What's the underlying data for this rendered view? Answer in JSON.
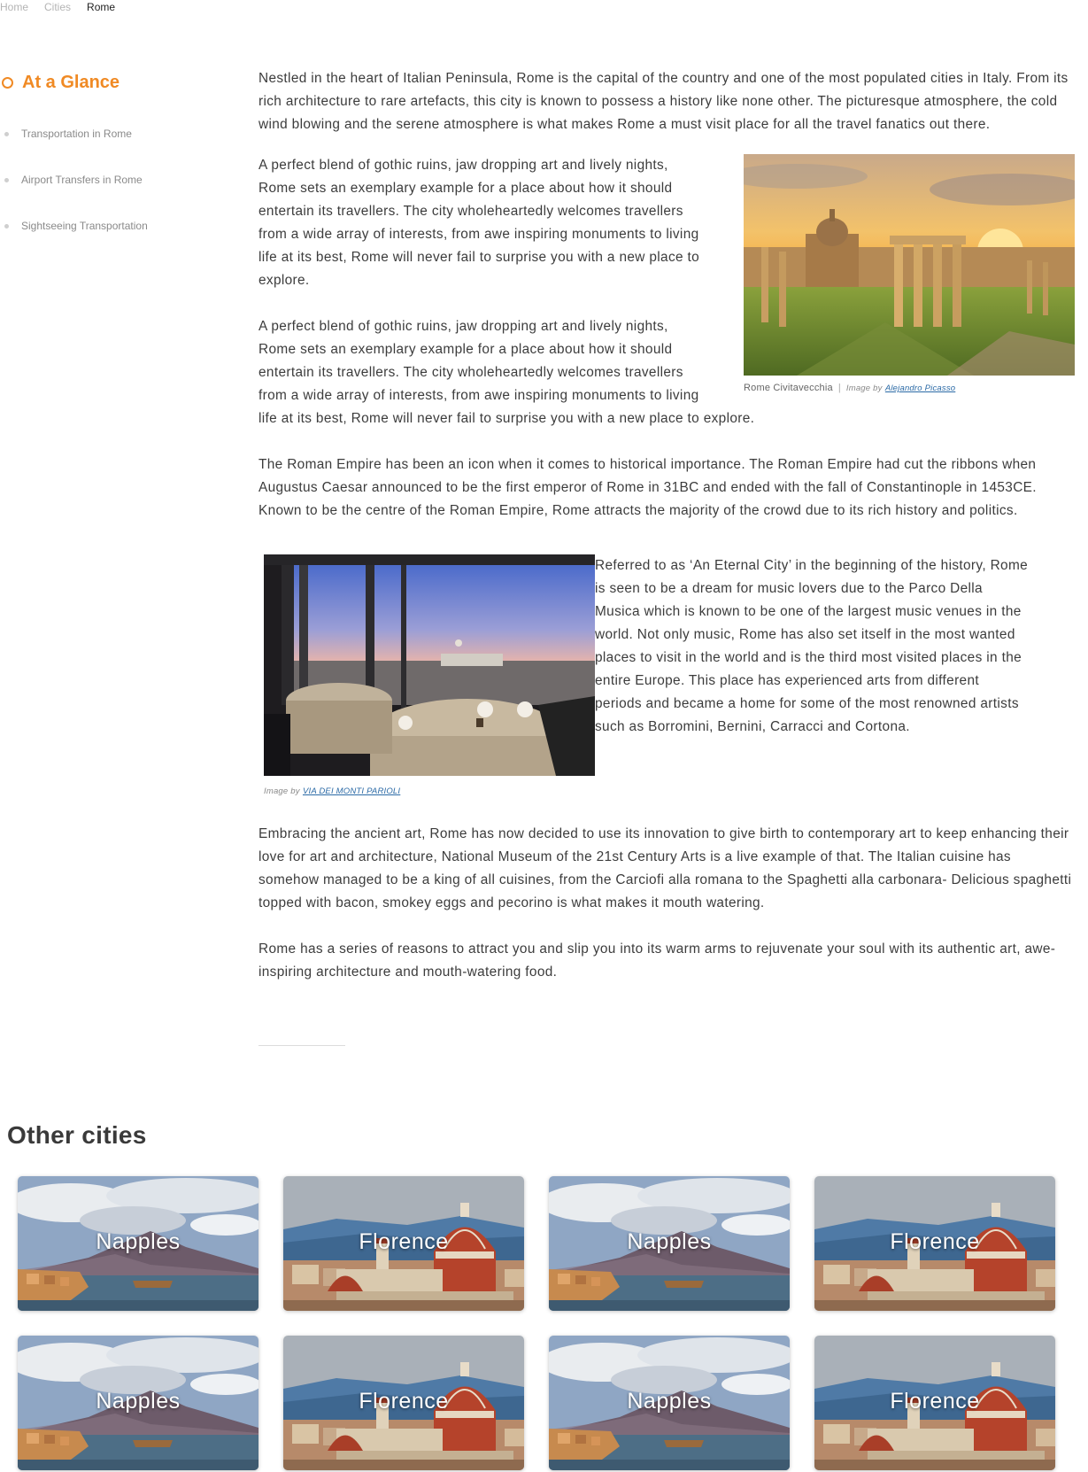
{
  "breadcrumb": {
    "home": "Home",
    "cities": "Cities",
    "current": "Rome"
  },
  "sidenav": {
    "active": "At a Glance",
    "items": [
      {
        "label": "Transportation in Rome"
      },
      {
        "label": "Airport Transfers in Rome"
      },
      {
        "label": "Sightseeing Transportation"
      }
    ]
  },
  "article": {
    "p1": "Nestled in the heart of Italian Peninsula, Rome is the capital of the country and one of the most populated cities in Italy. From its rich architecture to rare artefacts, this city is known to possess a history like none other. The picturesque atmosphere, the cold wind blowing and the serene atmosphere is what makes Rome a must visit place for all the travel fanatics out there.",
    "p2": "A perfect blend of gothic ruins, jaw dropping art and lively nights, Rome sets an exemplary example for a place about how it should entertain its travellers. The city wholeheartedly welcomes travellers from a wide array of interests, from awe inspiring monuments to living life at its best, Rome will never fail to surprise you with a new place to explore.",
    "p3": "A perfect blend of gothic ruins, jaw dropping art and lively nights, Rome sets an exemplary example for a place about how it should entertain its travellers. The city wholeheartedly welcomes travellers from a wide array of interests, from awe inspiring monuments to living life at its best, Rome will never fail to surprise you with a new place to explore.",
    "p4": "The Roman Empire has been an icon when it comes to historical importance. The Roman Empire had cut the ribbons when Augustus Caesar announced to be the first emperor of Rome in 31BC and ended with the fall of Constantinople in 1453CE. Known to be the centre of the Roman Empire, Rome attracts the majority of the crowd due to its rich history and politics.",
    "p5": "Referred to as ‘An Eternal City’ in the beginning of the history, Rome is seen to be a dream for music lovers due to the Parco Della Musica which is known to be one of the largest music venues in the world. Not only music, Rome has also set itself in the most wanted places to visit in the world and is the third most visited places in the entire Europe. This place has experienced arts from different periods and became a home for some of the most renowned artists such as Borromini, Bernini, Carracci and Cortona.",
    "p6": "Embracing the ancient art, Rome has now decided to use its innovation to give birth to contemporary art to keep enhancing their love for art and architecture, National Museum of the 21st Century Arts is a live example of that. The Italian cuisine has somehow managed to be a king of all cuisines, from the Carciofi alla romana to the Spaghetti alla carbonara- Delicious spaghetti topped with bacon, smokey eggs and pecorino is what makes it mouth watering.",
    "p7": "Rome has a series of reasons to attract you and slip you into its warm arms to rejuvenate your soul with its authentic art, awe-inspiring architecture and mouth-watering food.",
    "image1": {
      "caption": "Rome Civitavecchia",
      "sep": "|",
      "by": "Image by",
      "credit": "Alejandro Picasso"
    },
    "image2": {
      "by": "Image by",
      "credit": "VIA DEI MONTI PARIOLI"
    }
  },
  "other_cities": {
    "title": "Other cities",
    "cards": [
      {
        "name": "Napples",
        "kind": "naples"
      },
      {
        "name": "Florence",
        "kind": "florence"
      },
      {
        "name": "Napples",
        "kind": "naples"
      },
      {
        "name": "Florence",
        "kind": "florence"
      },
      {
        "name": "Napples",
        "kind": "naples"
      },
      {
        "name": "Florence",
        "kind": "florence"
      },
      {
        "name": "Napples",
        "kind": "naples"
      },
      {
        "name": "Florence",
        "kind": "florence"
      }
    ]
  },
  "colors": {
    "accent": "#f08a24",
    "link": "#2b6aa6"
  }
}
